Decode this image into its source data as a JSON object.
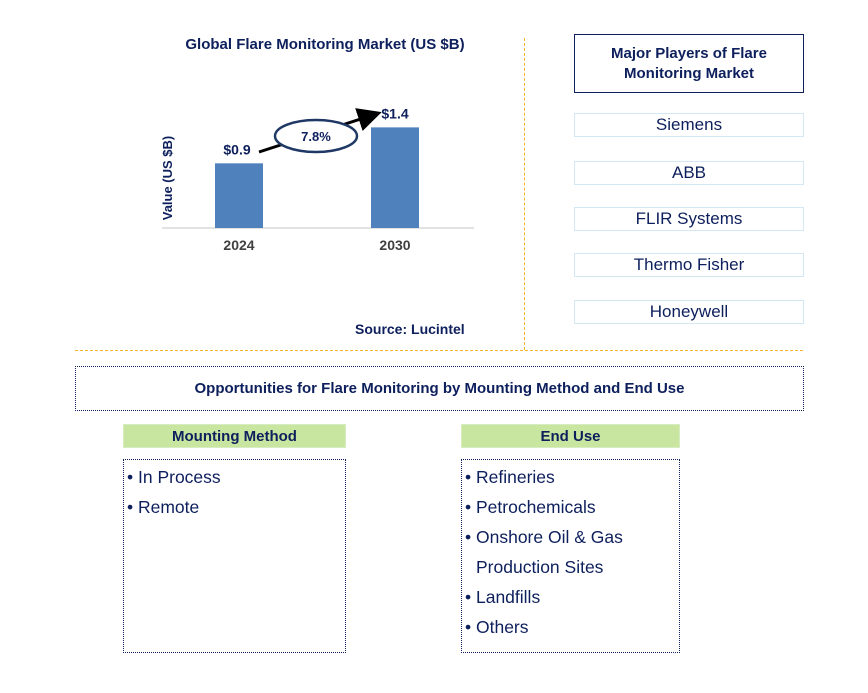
{
  "chart_data": {
    "type": "bar",
    "title": "Global Flare Monitoring Market (US $B)",
    "xlabel": "",
    "ylabel": "Value (US $B)",
    "categories": [
      "2024",
      "2030"
    ],
    "values": [
      0.9,
      1.4
    ],
    "data_labels": [
      "$0.9",
      "$1.4"
    ],
    "ylim": [
      0,
      1.6
    ],
    "grid": false,
    "bar_color": "#4f81bd",
    "annotation": {
      "type": "cagr-arrow",
      "label": "7.8%",
      "from": "2024",
      "to": "2030"
    }
  },
  "source": "Source: Lucintel",
  "players": {
    "title": "Major Players of Flare Monitoring Market",
    "items": [
      "Siemens",
      "ABB",
      "FLIR Systems",
      "Thermo Fisher",
      "Honeywell"
    ]
  },
  "opportunities": {
    "title": "Opportunities for Flare Monitoring by Mounting Method and End Use",
    "mounting": {
      "header": "Mounting Method",
      "items": [
        "• In Process",
        "• Remote"
      ]
    },
    "end_use": {
      "header": "End Use",
      "items": [
        "• Refineries",
        "• Petrochemicals",
        "• Onshore Oil & Gas",
        "Production Sites",
        "• Landfills",
        "• Others"
      ]
    }
  },
  "colors": {
    "text": "#0d1f5c",
    "bar": "#4f81bd",
    "separator": "#f5b52a",
    "category_header": "#c8e6a0",
    "player_border": "#d3e7f5"
  }
}
